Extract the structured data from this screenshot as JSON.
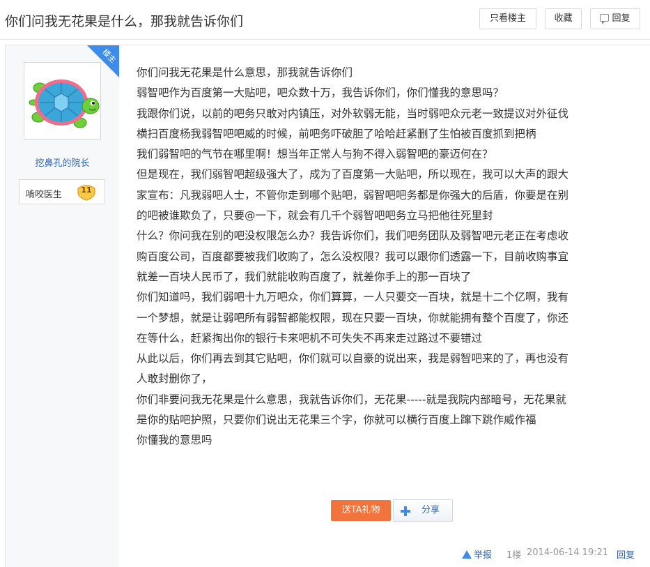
{
  "header": {
    "title": "你们问我无花果是什么，那我就告诉你们",
    "only_op_label": "只看楼主",
    "favorite_label": "收藏",
    "reply_label": "回复"
  },
  "author": {
    "badge": "楼主",
    "username": "挖鼻孔的院长",
    "level_name": "啃咬医生",
    "level": "11"
  },
  "post": {
    "lines": [
      "你们问我无花果是什么意思，那我就告诉你们",
      "弱智吧作为百度第一大贴吧，吧众数十万，我告诉你们，你们懂我的意思吗？",
      "我跟你们说，以前的吧务只敢对内镇压，对外软弱无能，当时弱吧众元老一致提议对外征伐",
      "横扫百度杨我弱智吧吧威的时候，前吧务吓破胆了哈哈赶紧删了生怕被百度抓到把柄",
      "我们弱智吧的气节在哪里啊！想当年正常人与狗不得入弱智吧的豪迈何在？",
      "但是现在，我们弱智吧超级强大了，成为了百度第一大贴吧，所以现在，我可以大声的跟大",
      "家宣布：凡我弱吧人士，不管你走到哪个贴吧，弱智吧吧务都是你强大的后盾，你要是在别",
      "的吧被谁欺负了，只要@一下，就会有几千个弱智吧吧务立马把他往死里封",
      "什么？你问我在别的吧没权限怎么办？我告诉你们，我们吧务团队及弱智吧元老正在考虑收",
      "购百度公司，百度都要被我们收购了，怎么没权限？我可以跟你们透露一下，目前收购事宜",
      "就差一百块人民币了，我们就能收购百度了，就差你手上的那一百块了",
      "你们知道吗，我们弱吧十九万吧众，你们算算，一人只要交一百块，就是十二个亿啊，我有",
      "一个梦想，就是让弱吧所有弱智都能权限，现在只要一百块，你就能拥有整个百度了，你还",
      "在等什么，赶紧掏出你的银行卡来吧机不可失失不再来走过路过不要错过",
      "从此以后，你们再去到其它贴吧，你们就可以自豪的说出来，我是弱智吧来的了，再也没有",
      "人敢封删你了，",
      "你们非要问我无花果是什么意思，我就告诉你们，无花果-----就是我院内部暗号，无花果就",
      "是你的贴吧护照，只要你们说出无花果三个字，你就可以横行百度上蹿下跳作威作福",
      "你懂我的意思吗"
    ],
    "gift_label": "送TA礼物",
    "share_label": "分享",
    "report_label": "举报",
    "floor": "1楼",
    "date": "2014-06-14 19:21",
    "reply_label": "回复"
  },
  "colors": {
    "link": "#2d64b3",
    "accent_blue": "#3e8be8",
    "gift_orange": "#f0743c",
    "turtle_green": "#6fcf3a",
    "turtle_shell": "#3aa7d8",
    "turtle_rim": "#f26c8c"
  },
  "icons": [
    "reply-icon",
    "share-plus-icon",
    "warning-icon",
    "level-badge-icon",
    "turtle-avatar"
  ]
}
